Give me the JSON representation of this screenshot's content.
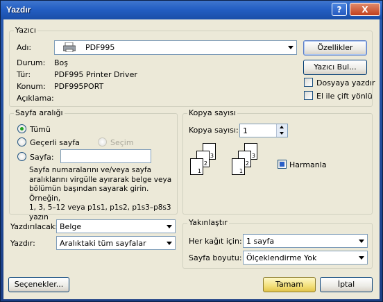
{
  "window": {
    "title": "Yazdır",
    "help": "?",
    "close": "X"
  },
  "printer": {
    "group_label": "Yazıcı",
    "name_label": "Adı:",
    "name_value": "PDF995",
    "status_label": "Durum:",
    "status_value": "Boş",
    "type_label": "Tür:",
    "type_value": "PDF995 Printer Driver",
    "location_label": "Konum:",
    "location_value": "PDF995PORT",
    "comment_label": "Açıklama:",
    "properties_button": "Özellikler",
    "find_button": "Yazıcı Bul...",
    "print_to_file": "Dosyaya yazdır",
    "manual_duplex": "El ile çift yönlü"
  },
  "range": {
    "group_label": "Sayfa aralığı",
    "all": "Tümü",
    "current": "Geçerli sayfa",
    "selection": "Seçim",
    "pages": "Sayfa:",
    "pages_value": "",
    "help_lines": [
      "Sayfa numaralarını ve/veya sayfa",
      "aralıklarını virgülle ayırarak belge veya",
      "bölümün başından sayarak girin. Örneğin,",
      "1, 3, 5–12 veya p1s1, p1s2, p1s3–p8s3",
      "yazın"
    ]
  },
  "copies": {
    "group_label": "Kopya sayısı",
    "count_label": "Kopya sayısı:",
    "count_value": "1",
    "collate": "Harmanla",
    "pages": [
      "1",
      "2",
      "3",
      "1",
      "2",
      "3"
    ]
  },
  "print_what": {
    "label": "Yazdırılacak:",
    "value": "Belge"
  },
  "print": {
    "label": "Yazdır:",
    "value": "Aralıktaki tüm sayfalar"
  },
  "zoom": {
    "group_label": "Yakınlaştır",
    "per_sheet_label": "Her kağıt için:",
    "per_sheet_value": "1 sayfa",
    "scale_label": "Sayfa boyutu:",
    "scale_value": "Ölçeklendirme Yok"
  },
  "footer": {
    "options": "Seçenekler...",
    "ok": "Tamam",
    "cancel": "İptal"
  },
  "colors": {
    "title_bar": "#245fc3",
    "face": "#ece9d8",
    "ok_button": "#f3e07a",
    "radio_dot": "#21a121"
  }
}
